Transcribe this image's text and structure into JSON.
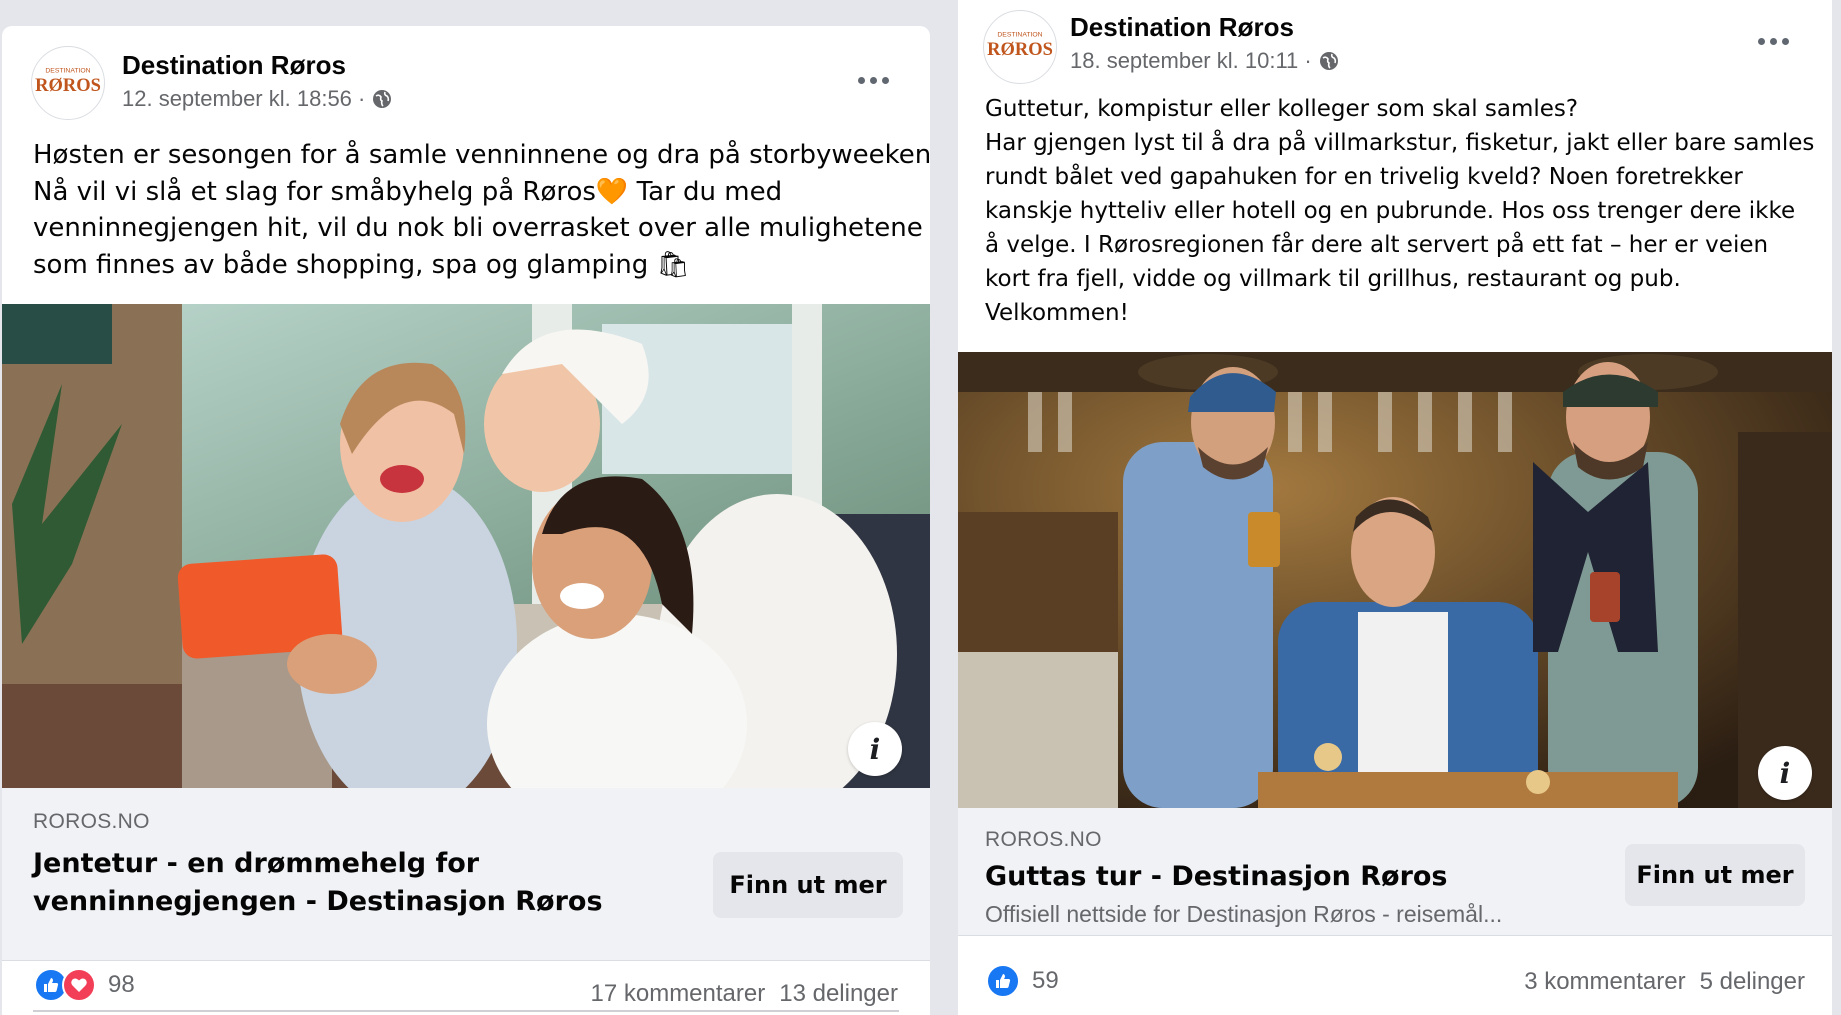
{
  "posts": [
    {
      "page_name": "Destination Røros",
      "logo_top": "DESTINATION",
      "logo_main": "RØROS",
      "timestamp": "12. september kl. 18:56 ·",
      "caption_lines": [
        "Høsten er sesongen for å samle venninnene og dra på storbyweekend.",
        "Nå vil vi slå et slag for småbyhelg på Røros🧡 Tar du med",
        "venninnegjengen hit, vil du nok bli overrasket over alle mulighetene",
        "som finnes av både shopping, spa og glamping 🛍"
      ],
      "photo": "selfie-women-spa",
      "info": "i",
      "link": {
        "domain": "ROROS.NO",
        "title_lines": [
          "Jentetur - en drømmehelg for",
          "venninnegjengen - Destinasjon Røros"
        ],
        "description": "",
        "cta": "Finn ut mer"
      },
      "reactions": {
        "count": "98",
        "types": [
          "like",
          "love"
        ]
      },
      "comments": "17 kommentarer",
      "shares": "13 delinger"
    },
    {
      "page_name": "Destination Røros",
      "logo_top": "DESTINATION",
      "logo_main": "RØROS",
      "timestamp": "18. september kl. 10:11 ·",
      "caption_lines": [
        "Guttetur, kompistur eller kolleger som skal samles?",
        "Har gjengen lyst til å dra på villmarkstur, fisketur, jakt eller bare samles",
        "rundt bålet ved gapahuken for en trivelig kveld? Noen foretrekker",
        "kanskje hytteliv eller hotell og en pubrunde. Hos oss trenger dere ikke",
        "å velge. I Rørosregionen får dere alt servert på ett fat – her er veien",
        "kort fra fjell, vidde og villmark til grillhus, restaurant og pub.",
        "Velkommen!"
      ],
      "photo": "men-pub-shuffleboard",
      "info": "i",
      "link": {
        "domain": "ROROS.NO",
        "title_lines": [
          "Guttas tur - Destinasjon Røros"
        ],
        "description": "Offisiell nettside for Destinasjon Røros - reisemål...",
        "cta": "Finn ut mer"
      },
      "reactions": {
        "count": "59",
        "types": [
          "like"
        ]
      },
      "comments": "3 kommentarer",
      "shares": "5 delinger"
    }
  ],
  "colors": {
    "facebook_blue": "#1877f2",
    "love_red": "#f33e58",
    "logo_orange": "#c0561e",
    "secondary_text": "#65676b"
  }
}
